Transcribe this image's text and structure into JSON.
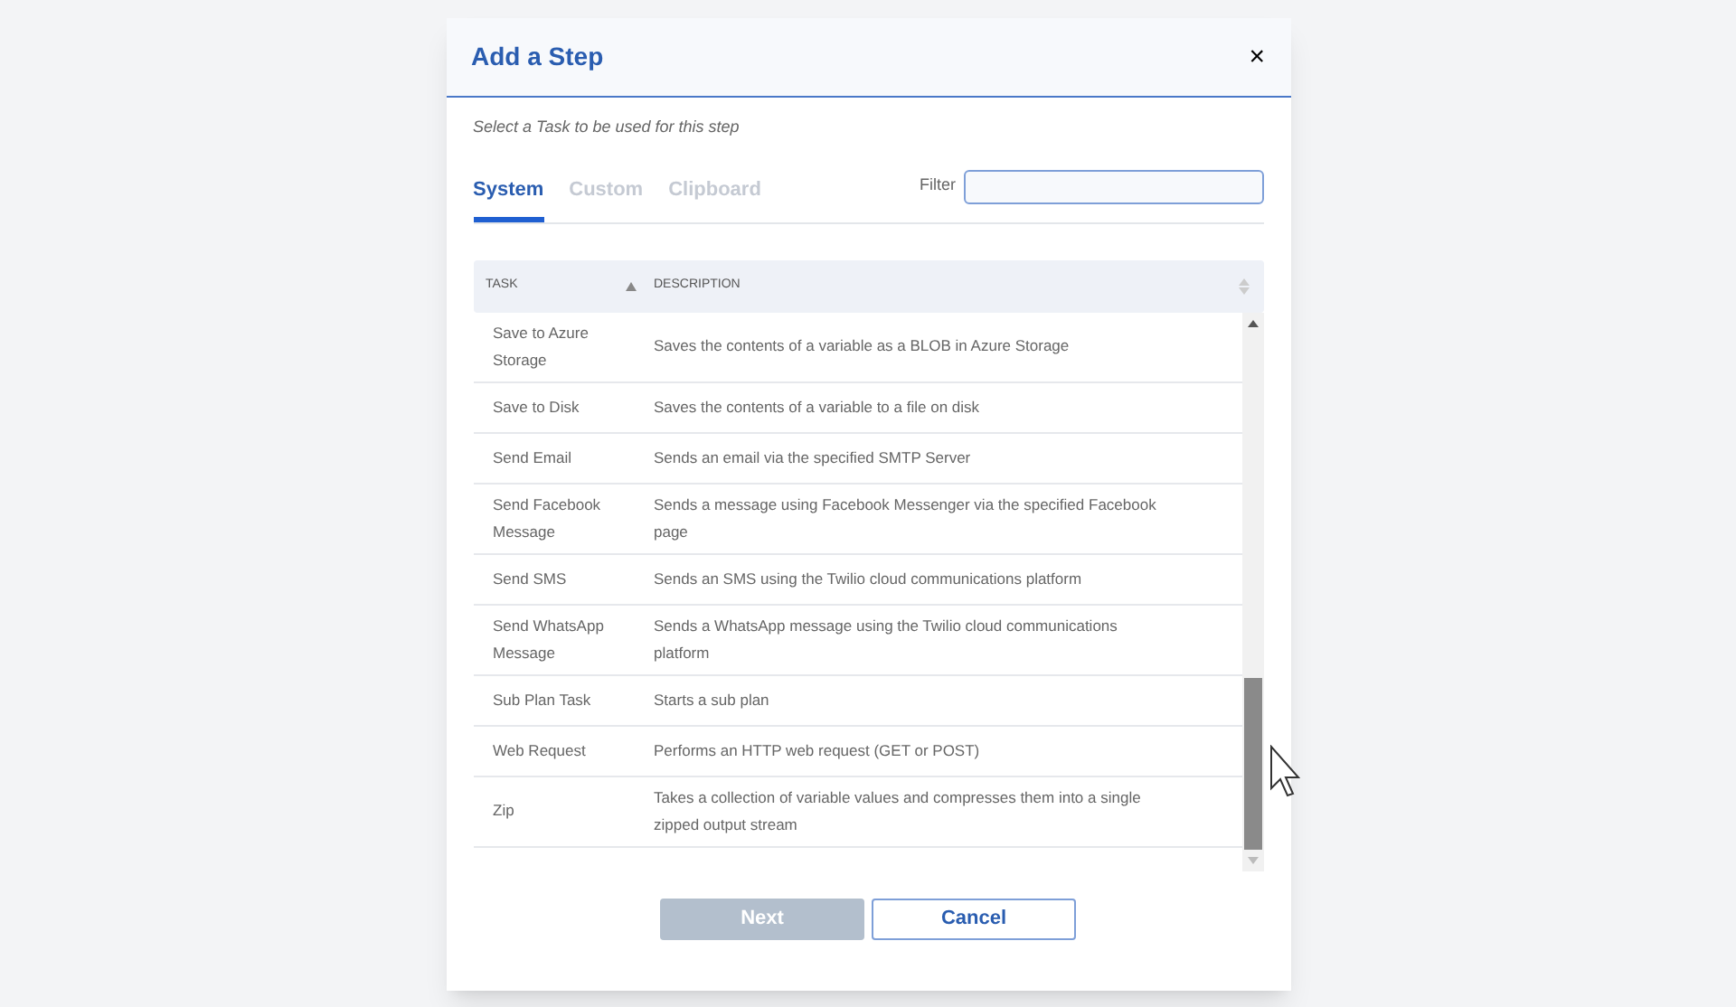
{
  "dialog": {
    "title": "Add a Step",
    "close": "×",
    "subtitle": "Select a Task to be used for this step"
  },
  "tabs": [
    {
      "label": "System",
      "selected": true
    },
    {
      "label": "Custom",
      "selected": false
    },
    {
      "label": "Clipboard",
      "selected": false
    }
  ],
  "filter": {
    "label": "Filter"
  },
  "table": {
    "columns": [
      {
        "label": "TASK",
        "sorted": true
      },
      {
        "label": "DESCRIPTION",
        "sorted": false
      }
    ],
    "rows": [
      [
        "Save to Azure Storage",
        "Saves the contents of a variable as a BLOB in Azure Storage"
      ],
      [
        "Save to Disk",
        "Saves the contents of a variable to a file on disk"
      ],
      [
        "Send Email",
        "Sends an email via the specified SMTP Server"
      ],
      [
        "Send Facebook Message",
        "Sends a message using Facebook Messenger via the specified Facebook page"
      ],
      [
        "Send SMS",
        "Sends an SMS using the Twilio cloud communications platform"
      ],
      [
        "Send WhatsApp Message",
        "Sends a WhatsApp message using the Twilio cloud communications platform"
      ],
      [
        "Sub Plan Task",
        "Starts a sub plan"
      ],
      [
        "Web Request",
        "Performs an HTTP web request (GET or POST)"
      ],
      [
        "Zip",
        "Takes a collection of variable values and compresses them into a single zipped output stream"
      ]
    ]
  },
  "buttons": [
    {
      "label": "Next",
      "kind": "primary",
      "disabled": true
    },
    {
      "label": "Cancel",
      "kind": "secondary",
      "disabled": false
    }
  ]
}
